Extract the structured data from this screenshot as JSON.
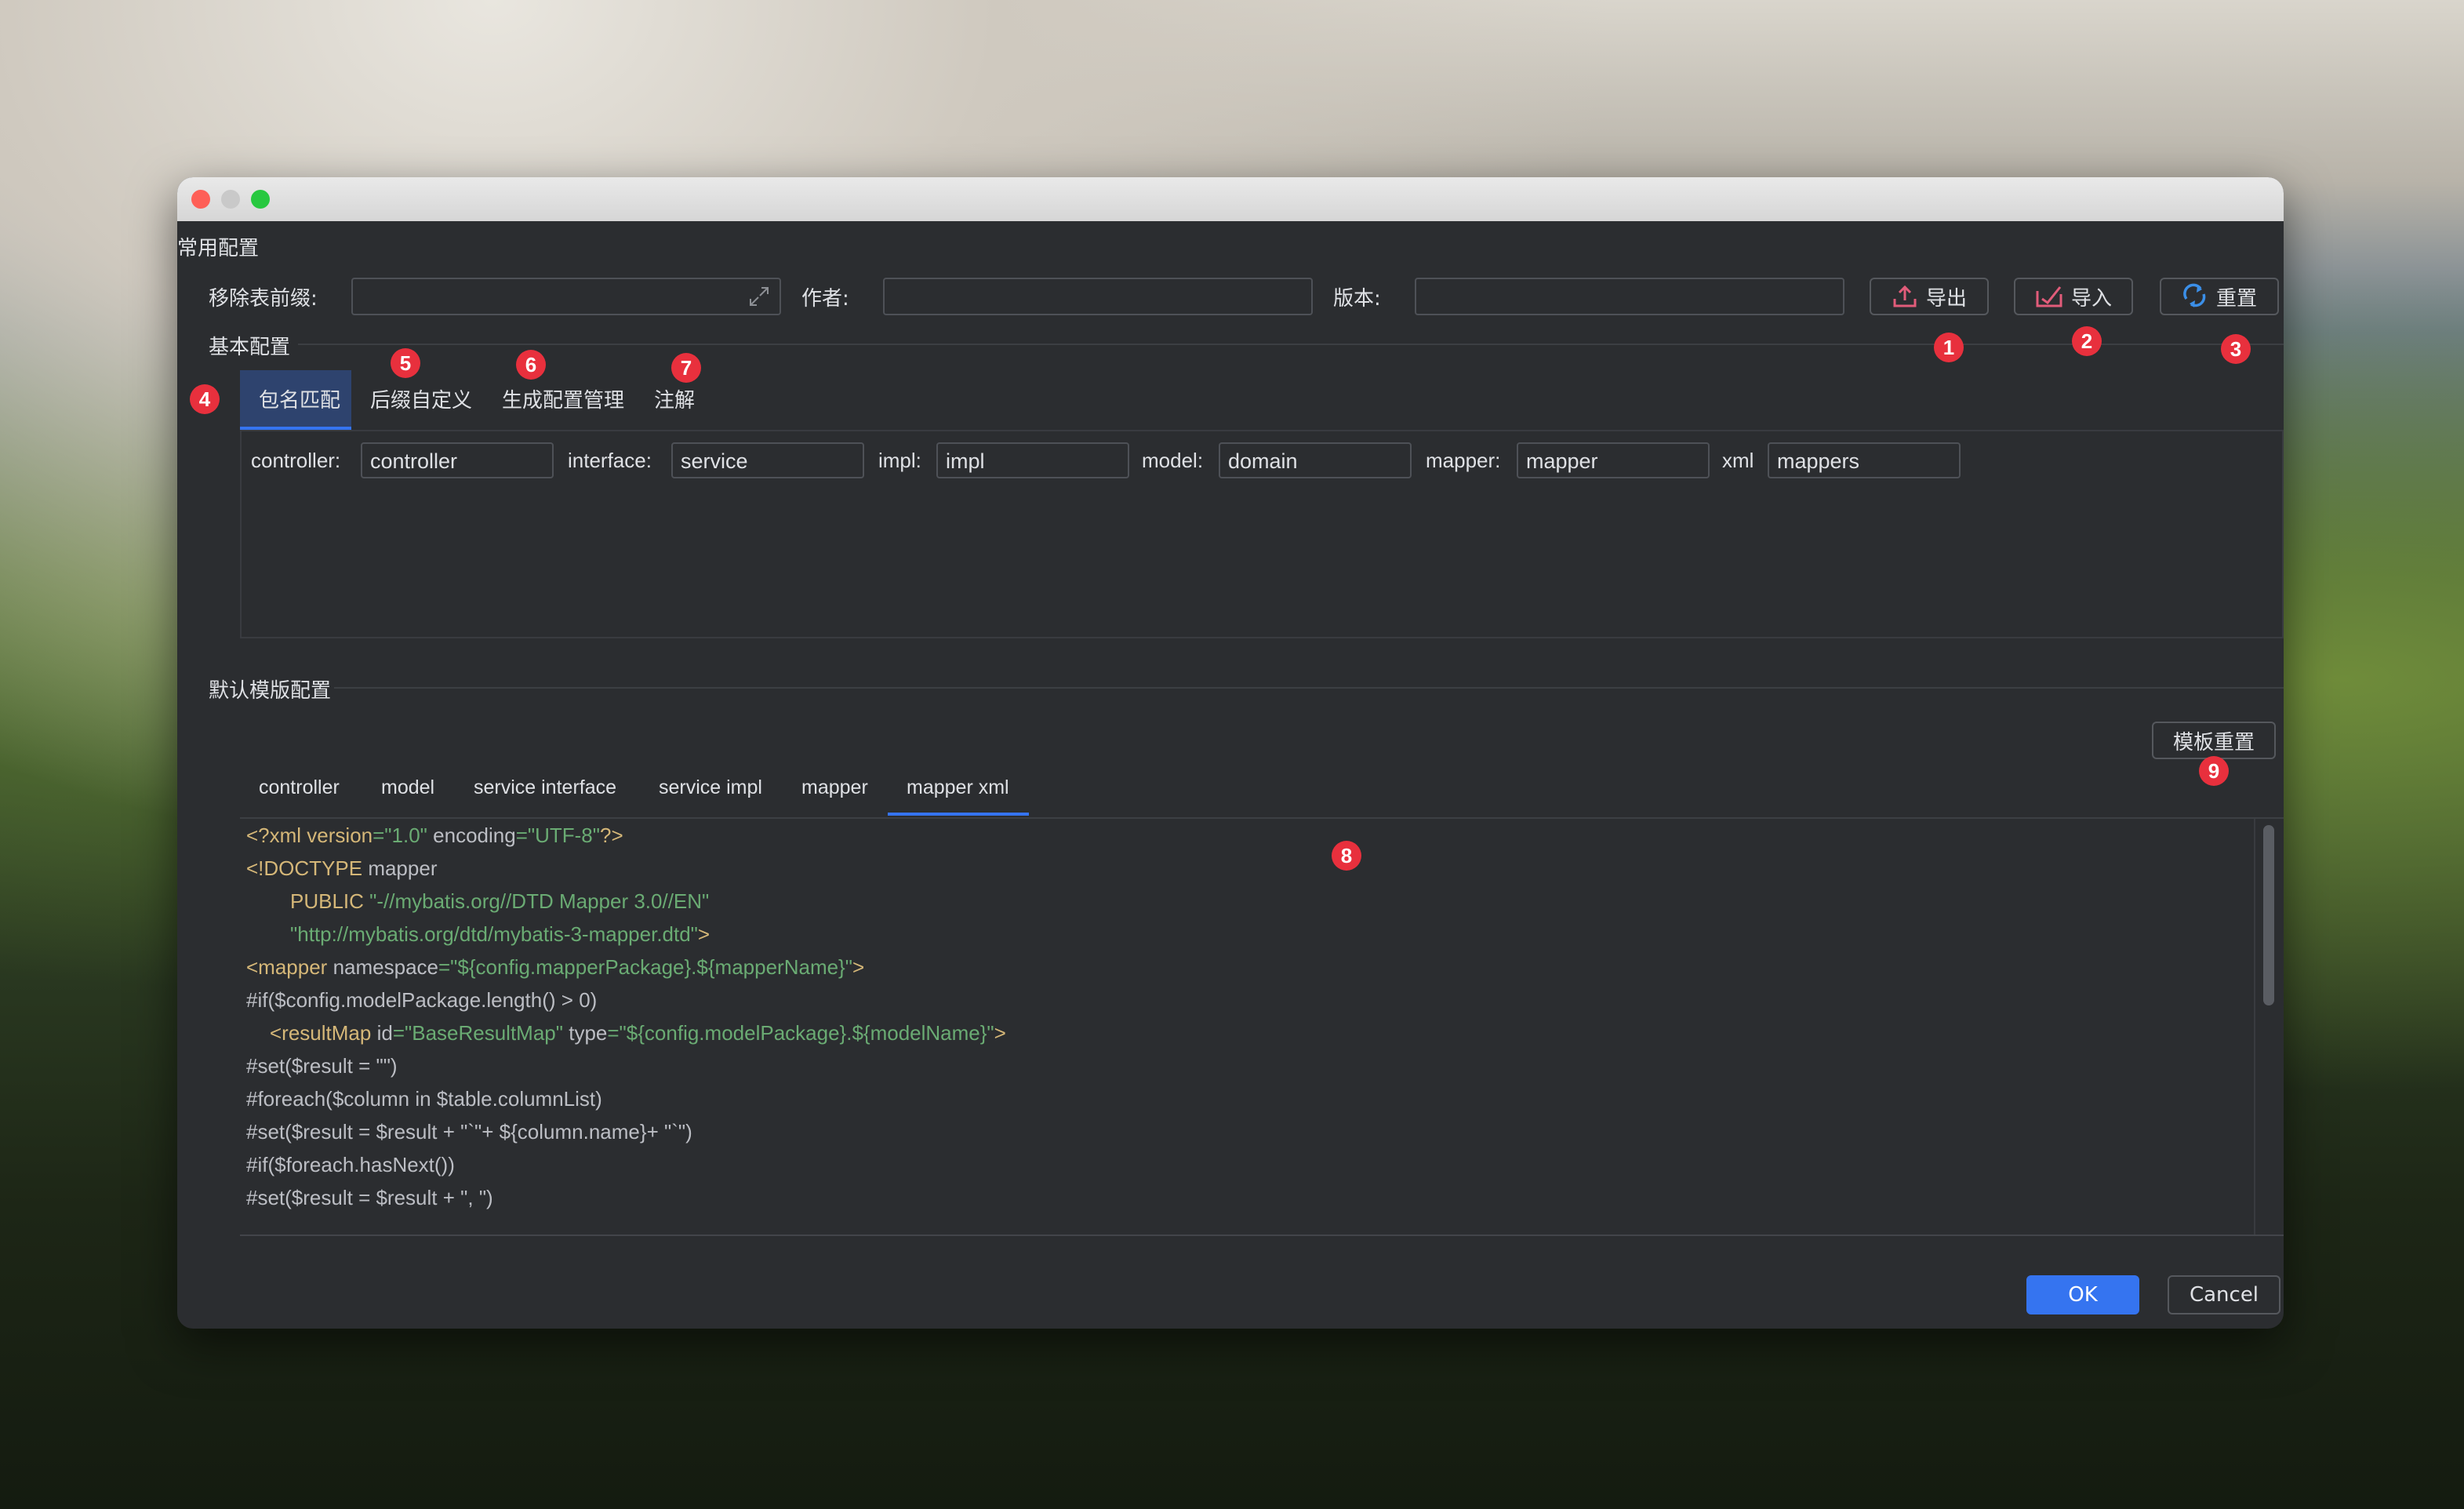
{
  "window": {
    "sections": {
      "common": "常用配置",
      "basic": "基本配置",
      "template": "默认模版配置"
    },
    "common": {
      "prefix_label": "移除表前缀:",
      "prefix_value": "",
      "author_label": "作者:",
      "author_value": "",
      "version_label": "版本:",
      "version_value": "",
      "export_label": "导出",
      "import_label": "导入",
      "reset_label": "重置"
    },
    "basic_tabs": [
      "包名匹配",
      "后缀自定义",
      "生成配置管理",
      "注解"
    ],
    "package_fields": [
      {
        "label": "controller:",
        "value": "controller"
      },
      {
        "label": "interface:",
        "value": "service"
      },
      {
        "label": "impl:",
        "value": "impl"
      },
      {
        "label": "model:",
        "value": "domain"
      },
      {
        "label": "mapper:",
        "value": "mapper"
      },
      {
        "label": "xml",
        "value": "mappers"
      }
    ],
    "template_reset_label": "模板重置",
    "template_tabs": [
      "controller",
      "model",
      "service interface",
      "service impl",
      "mapper",
      "mapper xml"
    ],
    "active_template_tab": "mapper xml",
    "code": {
      "l1": [
        "<?xml version",
        "=\"1.0\"",
        " encoding",
        "=\"UTF-8\"",
        "?>"
      ],
      "l2": [
        "<!DOCTYPE",
        " mapper"
      ],
      "l3": [
        "PUBLIC",
        " \"-//mybatis.org//DTD Mapper 3.0//EN\""
      ],
      "l4": [
        "\"http://mybatis.org/dtd/mybatis-3-mapper.dtd\"",
        ">"
      ],
      "l5": [
        "<mapper",
        " namespace",
        "=\"${config.mapperPackage}.${mapperName}\"",
        ">"
      ],
      "l6": "#if($config.modelPackage.length() > 0)",
      "l7": [
        "<resultMap",
        " id",
        "=\"BaseResultMap\"",
        " type",
        "=\"${config.modelPackage}.${modelName}\"",
        ">"
      ],
      "l8": "#set($result = \"\")",
      "l9": "#foreach($column in $table.columnList)",
      "l10": "#set($result = $result + \"`\"+ ${column.name}+ \"`\")",
      "l11": "#if($foreach.hasNext())",
      "l12": "#set($result = $result + \", \")"
    },
    "ok_label": "OK",
    "cancel_label": "Cancel",
    "badges": [
      "1",
      "2",
      "3",
      "4",
      "5",
      "6",
      "7",
      "8",
      "9"
    ]
  }
}
